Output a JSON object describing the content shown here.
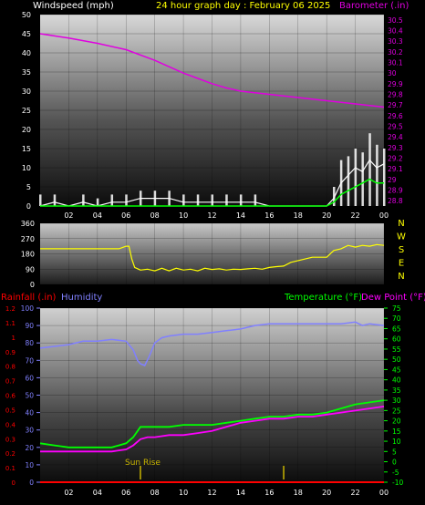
{
  "header": {
    "left_label": "Windspeed (mph)",
    "title": "24 hour graph day : February 06 2025",
    "right_label": "Barometer (.in)"
  },
  "colors": {
    "background": "#000000",
    "wind": "#ffffff",
    "gust_fill": "#ffffff",
    "barometer": "#e000e0",
    "wind_avg": "#00ff00",
    "direction": "#ffff00",
    "rainfall": "#ff0000",
    "humidity": "#8080ff",
    "temperature": "#00ff00",
    "dew_point": "#ff00ff",
    "title_color": "#ffff00",
    "sunrise_color": "#c8b400"
  },
  "chart_data": [
    {
      "type": "line",
      "name": "wind-barometer-panel",
      "x_tick_labels": [
        "02",
        "04",
        "06",
        "08",
        "10",
        "12",
        "14",
        "16",
        "18",
        "20",
        "22",
        "00"
      ],
      "left_axis": {
        "label": "Windspeed (mph)",
        "ticks": [
          0,
          5,
          10,
          15,
          20,
          25,
          30,
          35,
          40,
          45,
          50
        ],
        "ylim": [
          0,
          50
        ]
      },
      "right_axis": {
        "label": "Barometer (.in)",
        "ticks": [
          "28.8",
          "28.9",
          "29",
          "29.1",
          "29.2",
          "29.3",
          "29.4",
          "29.5",
          "29.6",
          "29.7",
          "29.8",
          "29.9",
          "30",
          "30.1",
          "30.2",
          "30.3",
          "30.4",
          "30.5"
        ],
        "ylim": [
          28.75,
          30.55
        ]
      },
      "barometer": {
        "x": [
          0,
          2,
          4,
          6,
          8,
          10,
          11,
          12,
          13,
          14,
          16,
          18,
          20,
          22,
          24
        ],
        "values": [
          30.37,
          30.33,
          30.28,
          30.22,
          30.12,
          30.0,
          29.95,
          29.9,
          29.86,
          29.83,
          29.8,
          29.77,
          29.74,
          29.71,
          29.68
        ]
      },
      "wind_speed": {
        "x": [
          0,
          1,
          2,
          3,
          4,
          5,
          6,
          7,
          8,
          9,
          10,
          11,
          12,
          13,
          14,
          15,
          16,
          17,
          18,
          19,
          20,
          20.5,
          21,
          21.5,
          22,
          22.5,
          23,
          23.5,
          24
        ],
        "values": [
          0,
          1,
          0,
          1,
          0,
          1,
          1,
          2,
          2,
          2,
          1,
          1,
          1,
          1,
          1,
          1,
          0,
          0,
          0,
          0,
          0,
          2,
          6,
          8,
          10,
          9,
          12,
          10,
          11
        ]
      },
      "wind_gust": {
        "x": [
          0,
          1,
          2,
          3,
          4,
          5,
          6,
          7,
          8,
          9,
          10,
          11,
          12,
          13,
          14,
          15,
          16,
          17,
          18,
          19,
          20,
          20.5,
          21,
          21.5,
          22,
          22.5,
          23,
          23.5,
          24
        ],
        "values": [
          3,
          3,
          0,
          3,
          2,
          3,
          3,
          4,
          4,
          4,
          3,
          3,
          3,
          3,
          3,
          3,
          0,
          0,
          0,
          0,
          0,
          5,
          12,
          13,
          15,
          14,
          19,
          16,
          15
        ]
      },
      "wind_average": {
        "x": [
          0,
          20,
          20.5,
          21,
          21.5,
          22,
          22.5,
          23,
          23.5,
          24
        ],
        "values": [
          0,
          0,
          1,
          3,
          4,
          5,
          6,
          7,
          6,
          6
        ]
      }
    },
    {
      "type": "line",
      "name": "wind-direction-panel",
      "left_axis": {
        "ticks": [
          0,
          90,
          180,
          270,
          360
        ],
        "ylim": [
          0,
          360
        ]
      },
      "right_axis": {
        "ticks": [
          "N",
          "W",
          "S",
          "E",
          "N"
        ]
      },
      "direction": {
        "x": [
          0,
          0.5,
          1,
          1.5,
          2,
          2.5,
          3,
          3.5,
          4,
          4.5,
          5,
          5.5,
          6,
          6.2,
          6.4,
          6.6,
          7,
          7.5,
          8,
          8.5,
          9,
          9.5,
          10,
          10.5,
          11,
          11.5,
          12,
          12.5,
          13,
          13.5,
          14,
          14.5,
          15,
          15.5,
          16,
          16.5,
          17,
          17.5,
          18,
          18.5,
          19,
          19.5,
          20,
          20.5,
          21,
          21.5,
          22,
          22.5,
          23,
          23.5,
          24
        ],
        "values": [
          210,
          210,
          210,
          210,
          210,
          210,
          210,
          210,
          210,
          210,
          210,
          210,
          225,
          225,
          150,
          100,
          85,
          90,
          80,
          95,
          80,
          95,
          85,
          90,
          80,
          95,
          88,
          92,
          85,
          90,
          88,
          92,
          95,
          90,
          100,
          105,
          108,
          130,
          140,
          150,
          160,
          160,
          160,
          200,
          210,
          230,
          220,
          230,
          225,
          235,
          230
        ]
      }
    },
    {
      "type": "line",
      "name": "temperature-humidity-panel",
      "header": {
        "rainfall_label": "Rainfall (.in)",
        "humidity_label": "Humidity",
        "temperature_label": "Temperature (°F)",
        "dew_point_label": "Dew Point (°F)"
      },
      "rainfall_axis": {
        "ticks": [
          "0",
          "0.1",
          "0.2",
          "0.3",
          "0.4",
          "0.5",
          "0.6",
          "0.7",
          "0.8",
          "0.9",
          "1",
          "1.1",
          "1.2"
        ],
        "ylim": [
          0,
          1.2
        ]
      },
      "humidity_axis": {
        "ticks": [
          0,
          10,
          20,
          30,
          40,
          50,
          60,
          70,
          80,
          90,
          100
        ],
        "ylim": [
          0,
          100
        ]
      },
      "temperature_axis": {
        "ticks": [
          -10,
          -5,
          0,
          5,
          10,
          15,
          20,
          25,
          30,
          35,
          40,
          45,
          50,
          55,
          60,
          65,
          70,
          75
        ],
        "ylim": [
          -10,
          75
        ]
      },
      "annotation": "Sun Rise",
      "sunrise_x": 7.0,
      "marker_x": [
        7.0,
        17.0
      ],
      "humidity": {
        "x": [
          0,
          1,
          2,
          3,
          4,
          5,
          6,
          6.5,
          6.8,
          7,
          7.3,
          7.6,
          8,
          8.5,
          9,
          10,
          11,
          12,
          13,
          14,
          15,
          16,
          17,
          18,
          19,
          20,
          21,
          22,
          22.5,
          23,
          24
        ],
        "values": [
          77,
          78,
          79,
          81,
          81,
          82,
          81,
          76,
          70,
          68,
          67,
          72,
          80,
          83,
          84,
          85,
          85,
          86,
          87,
          88,
          90,
          91,
          91,
          91,
          91,
          91,
          91,
          92,
          90,
          91,
          90
        ]
      },
      "temperature": {
        "x": [
          0,
          1,
          2,
          3,
          4,
          5,
          6,
          6.5,
          7,
          7.5,
          8,
          9,
          10,
          11,
          12,
          13,
          14,
          15,
          16,
          17,
          18,
          19,
          20,
          21,
          22,
          23,
          24
        ],
        "values": [
          9,
          8,
          7,
          7,
          7,
          7,
          9,
          12,
          17,
          17,
          17,
          17,
          18,
          18,
          18,
          19,
          20,
          21,
          22,
          22,
          23,
          23,
          24,
          26,
          28,
          29,
          30
        ]
      },
      "dew_point": {
        "x": [
          0,
          1,
          2,
          3,
          4,
          5,
          6,
          6.5,
          7,
          7.5,
          8,
          9,
          10,
          11,
          12,
          13,
          14,
          15,
          16,
          17,
          18,
          19,
          20,
          21,
          22,
          23,
          24
        ],
        "values": [
          5,
          5,
          5,
          5,
          5,
          5,
          6,
          8,
          11,
          12,
          12,
          13,
          13,
          14,
          15,
          17,
          19,
          20,
          21,
          21,
          22,
          22,
          23,
          24,
          25,
          26,
          27
        ]
      },
      "rainfall": {
        "x": [
          0,
          24
        ],
        "values": [
          0,
          0
        ]
      }
    }
  ]
}
